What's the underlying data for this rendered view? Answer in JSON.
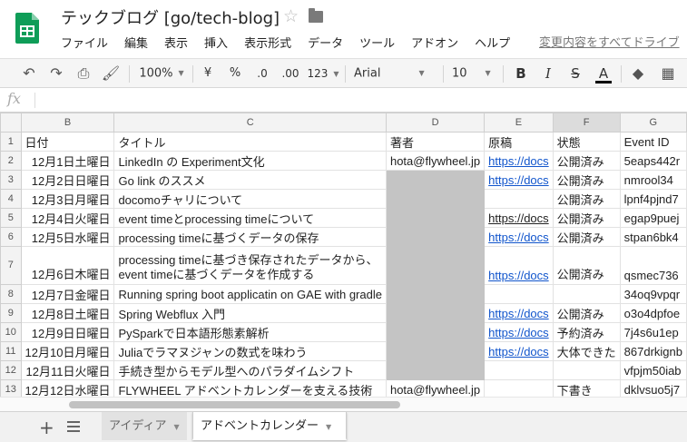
{
  "app": {
    "title": "テックブログ [go/tech-blog]",
    "menu": [
      "ファイル",
      "編集",
      "表示",
      "挿入",
      "表示形式",
      "データ",
      "ツール",
      "アドオン",
      "ヘルプ"
    ],
    "save_status": "変更内容をすべてドライブ"
  },
  "toolbar": {
    "zoom": "100%",
    "currency": "¥",
    "percent": "%",
    "decimal_decrease": ".0",
    "decimal_increase": ".00",
    "more_formats": "123",
    "font": "Arial",
    "font_size": "10",
    "bold": "B",
    "italic": "I",
    "strikethrough": "S",
    "text_color": "A"
  },
  "formula_bar": {
    "fx": "fx",
    "value": ""
  },
  "grid": {
    "columns": [
      "B",
      "C",
      "D",
      "E",
      "F",
      "G"
    ],
    "rows": [
      {
        "n": "1",
        "date": "日付",
        "title": "タイトル",
        "author": "著者",
        "draft": "原稿",
        "status": "状態",
        "event": "Event ID"
      },
      {
        "n": "2",
        "date": "12月1日土曜日",
        "title": "LinkedIn の Experiment文化",
        "author": "hota@flywheel.jp",
        "draft": "https://docs",
        "status": "公開済み",
        "event": "5eaps442r"
      },
      {
        "n": "3",
        "date": "12月2日日曜日",
        "title": "Go link のススメ",
        "author": "",
        "draft": "https://docs",
        "status": "公開済み",
        "event": "nmrool34"
      },
      {
        "n": "4",
        "date": "12月3日月曜日",
        "title": "docomoチャリについて",
        "author": "",
        "draft": "",
        "status": "公開済み",
        "event": "lpnf4pjnd7"
      },
      {
        "n": "5",
        "date": "12月4日火曜日",
        "title": "event timeとprocessing timeについて",
        "author": "",
        "draft": "https://docs",
        "status": "公開済み",
        "event": "egap9puej"
      },
      {
        "n": "6",
        "date": "12月5日水曜日",
        "title": "processing timeに基づくデータの保存",
        "author": "",
        "draft": "https://docs",
        "status": "公開済み",
        "event": "stpan6bk4"
      },
      {
        "n": "7",
        "date": "12月6日木曜日",
        "title": "processing timeに基づき保存されたデータから、event timeに基づくデータを作成する",
        "author": "",
        "draft": "https://docs",
        "status": "公開済み",
        "event": "qsmec736"
      },
      {
        "n": "8",
        "date": "12月7日金曜日",
        "title": "Running spring boot applicatin on GAE with gradle",
        "author": "",
        "draft": "",
        "status": "",
        "event": "34oq9vpqr"
      },
      {
        "n": "9",
        "date": "12月8日土曜日",
        "title": "Spring Webflux 入門",
        "author": "",
        "draft": "https://docs",
        "status": "公開済み",
        "event": "o3o4dpfoe"
      },
      {
        "n": "10",
        "date": "12月9日日曜日",
        "title": "PySparkで日本語形態素解析",
        "author": "",
        "draft": "https://docs",
        "status": "予約済み",
        "event": "7j4s6u1ep"
      },
      {
        "n": "11",
        "date": "12月10日月曜日",
        "title": "Juliaでラマヌジャンの数式を味わう",
        "author": "",
        "draft": "https://docs",
        "status": "大体できた",
        "event": "867drkignb"
      },
      {
        "n": "12",
        "date": "12月11日火曜日",
        "title": "手続き型からモデル型へのパラダイムシフト",
        "author": "",
        "draft": "",
        "status": "",
        "event": "vfpjm50iab"
      },
      {
        "n": "13",
        "date": "12月12日水曜日",
        "title": "FLYWHEEL アドベントカレンダーを支える技術",
        "author": "hota@flywheel.jp",
        "draft": "",
        "status": "下書き",
        "event": "dklvsuo5j7"
      }
    ]
  },
  "sheets": [
    {
      "label": "アイディア",
      "active": false
    },
    {
      "label": "アドベントカレンダー",
      "active": true
    }
  ],
  "colors": {
    "brand": "#0f9d58",
    "link": "#1155cc",
    "redacted": "#c4c4c4"
  }
}
